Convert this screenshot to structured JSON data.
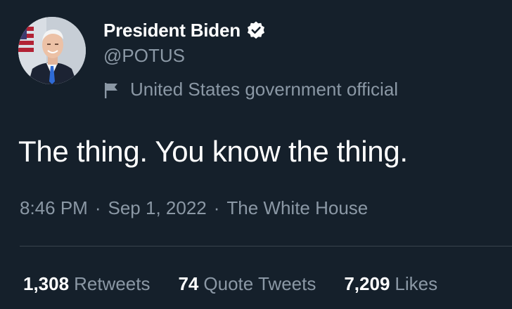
{
  "author": {
    "display_name": "President Biden",
    "handle": "@POTUS",
    "verified_icon": "verified-badge-icon",
    "account_label": "United States government official",
    "label_icon": "flag-icon"
  },
  "tweet": {
    "text": "The thing. You know the thing.",
    "time": "8:46 PM",
    "separator_1": "·",
    "date": "Sep 1, 2022",
    "separator_2": "·",
    "source": "The White House"
  },
  "stats": {
    "retweets_count": "1,308",
    "retweets_label": "Retweets",
    "quote_tweets_count": "74",
    "quote_tweets_label": "Quote Tweets",
    "likes_count": "7,209",
    "likes_label": "Likes"
  },
  "colors": {
    "background": "#15202b",
    "primary_text": "#ffffff",
    "secondary_text": "#8b98a5",
    "divider": "#38444d"
  }
}
